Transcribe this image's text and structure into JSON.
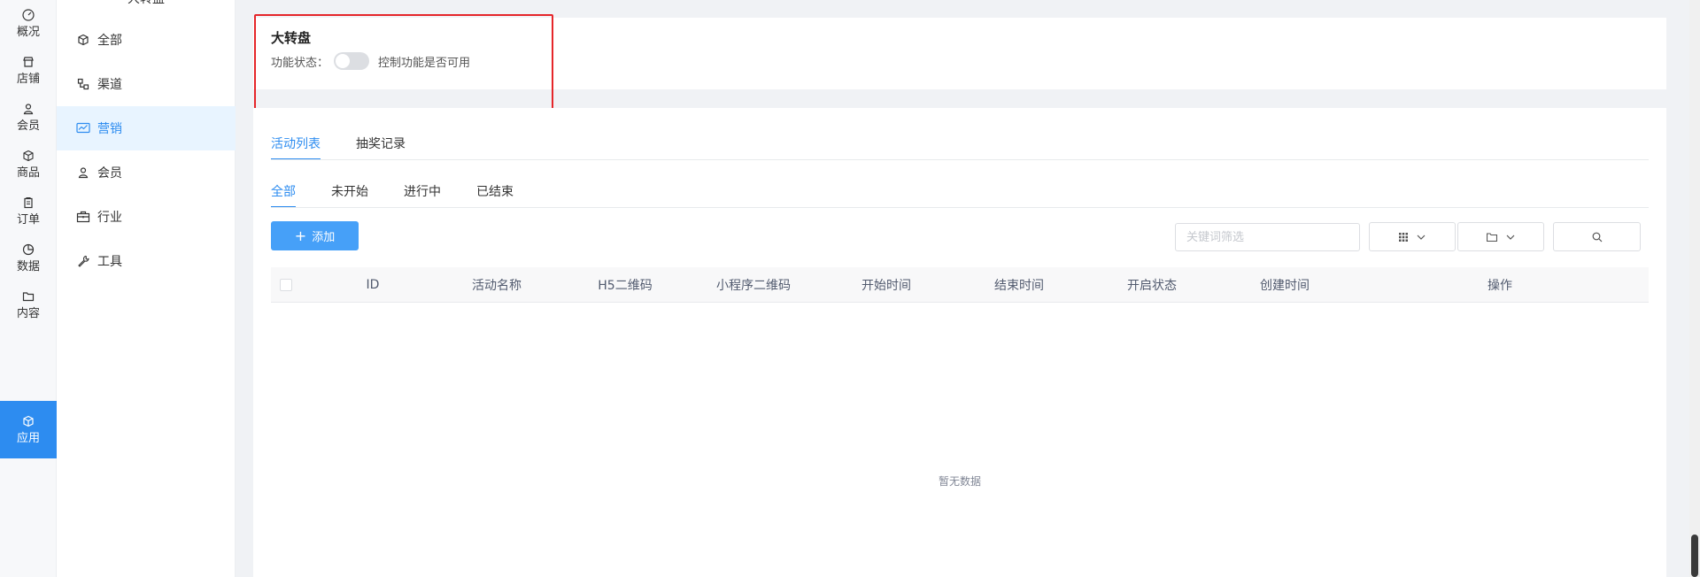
{
  "rail": {
    "items": [
      {
        "label": "概况",
        "icon": "dashboard-icon"
      },
      {
        "label": "店铺",
        "icon": "store-icon"
      },
      {
        "label": "会员",
        "icon": "user-icon"
      },
      {
        "label": "商品",
        "icon": "box-icon"
      },
      {
        "label": "订单",
        "icon": "clipboard-icon"
      },
      {
        "label": "数据",
        "icon": "pie-chart-icon"
      },
      {
        "label": "内容",
        "icon": "folder-icon"
      },
      {
        "label": "应用",
        "icon": "cube-icon"
      }
    ],
    "active_index": 7
  },
  "submenu": {
    "title": "大转盘",
    "items": [
      {
        "label": "全部",
        "icon": "cube-icon"
      },
      {
        "label": "渠道",
        "icon": "channel-icon"
      },
      {
        "label": "营销",
        "icon": "marketing-chart-icon"
      },
      {
        "label": "会员",
        "icon": "user-icon"
      },
      {
        "label": "行业",
        "icon": "briefcase-icon"
      },
      {
        "label": "工具",
        "icon": "wrench-icon"
      }
    ],
    "active_index": 2
  },
  "feature": {
    "title": "大转盘",
    "status_label": "功能状态：",
    "switch_on": false,
    "hint": "控制功能是否可用"
  },
  "main_tabs": {
    "items": [
      "活动列表",
      "抽奖记录"
    ],
    "active_index": 0
  },
  "filter_tabs": {
    "items": [
      "全部",
      "未开始",
      "进行中",
      "已结束"
    ],
    "active_index": 0
  },
  "toolbar": {
    "add_label": "添加",
    "search_placeholder": "关键词筛选"
  },
  "table": {
    "columns": [
      "ID",
      "活动名称",
      "H5二维码",
      "小程序二维码",
      "开始时间",
      "结束时间",
      "开启状态",
      "创建时间",
      "操作"
    ],
    "empty_text": "暂无数据"
  },
  "colors": {
    "accent": "#2d8cf0",
    "add_button": "#46a0f8",
    "highlight": "#e5262a"
  }
}
